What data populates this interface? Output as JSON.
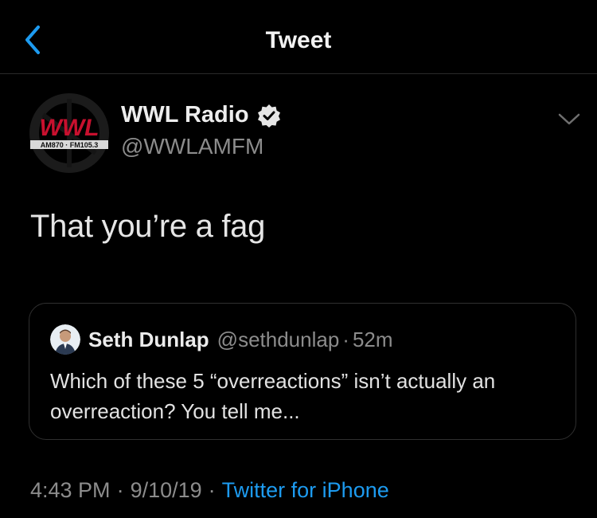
{
  "nav": {
    "title": "Tweet"
  },
  "tweet": {
    "author_name": "WWL Radio",
    "author_handle": "@WWLAMFM",
    "avatar_logo_text": "WWL",
    "avatar_logo_sub": "AM870 · FM105.3",
    "text": "That you’re a fag",
    "time": "4:43 PM",
    "date": "9/10/19",
    "source": "Twitter for iPhone"
  },
  "quote": {
    "author_name": "Seth Dunlap",
    "author_handle": "@sethdunlap",
    "time": "52m",
    "text": "Which of these 5 “overreactions” isn’t actually an overreaction?  You tell me..."
  },
  "colors": {
    "background": "#000000",
    "link": "#1d9bf0",
    "secondary_text": "#8c8c8c",
    "logo_red": "#c8102e"
  },
  "icons": [
    "back-chevron-icon",
    "verified-badge-icon",
    "chevron-down-icon"
  ]
}
